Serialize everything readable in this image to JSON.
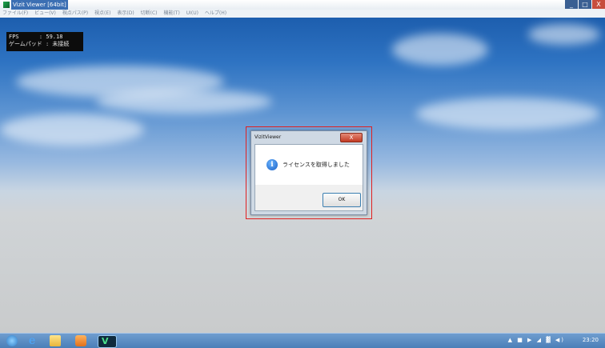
{
  "window": {
    "title": "Vizit Viewer [64bit]",
    "controls": {
      "minimize": "_",
      "maximize": "□",
      "close": "X"
    }
  },
  "menu": {
    "items": [
      "ファイル(F)",
      "ビュー(V)",
      "視点パス(P)",
      "視点(E)",
      "表示(D)",
      "切断(C)",
      "機能(T)",
      "UI(U)",
      "ヘルプ(H)"
    ]
  },
  "overlay": {
    "fps_line": "FPS      : 59.18",
    "gamepad_line": "ゲームパッド : 未接続"
  },
  "dialog": {
    "title": "VizitViewer",
    "close_label": "X",
    "message": "ライセンスを取得しました",
    "ok_label": "OK",
    "icon": "info-icon"
  },
  "taskbar": {
    "icons": [
      "start-orb-icon",
      "internet-explorer-icon",
      "folder-icon",
      "media-player-icon",
      "vizit-viewer-icon"
    ],
    "vizit_mark": "V",
    "tray_text": "▲ ■ ▶ ◢ ▓ ◀)",
    "clock": "23:20"
  },
  "colors": {
    "highlight": "#e02020",
    "sky_top": "#1d5eae",
    "taskbar": "#4b7fb8"
  }
}
